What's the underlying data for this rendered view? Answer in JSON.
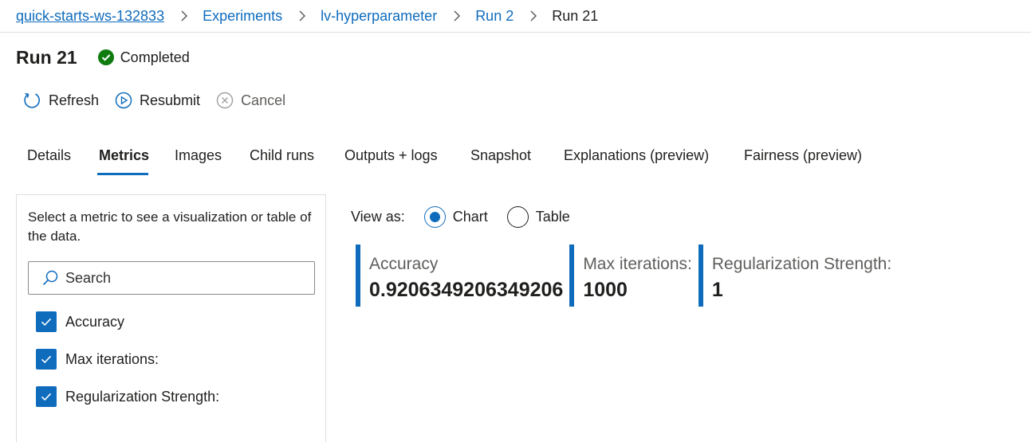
{
  "breadcrumb": {
    "items": [
      "quick-starts-ws-132833",
      "Experiments",
      "lv-hyperparameter",
      "Run 2"
    ],
    "current": "Run 21"
  },
  "header": {
    "title": "Run 21",
    "status": "Completed",
    "status_color": "#107c10"
  },
  "toolbar": {
    "refresh_label": "Refresh",
    "resubmit_label": "Resubmit",
    "cancel_label": "Cancel"
  },
  "tabs": [
    "Details",
    "Metrics",
    "Images",
    "Child runs",
    "Outputs + logs",
    "Snapshot",
    "Explanations (preview)",
    "Fairness (preview)"
  ],
  "active_tab": "Metrics",
  "left_panel": {
    "description": "Select a metric to see a visualization or table of the data.",
    "search_placeholder": "Search",
    "metrics": [
      "Accuracy",
      "Max iterations:",
      "Regularization Strength:"
    ]
  },
  "view_as": {
    "label": "View as:",
    "options": [
      "Chart",
      "Table"
    ],
    "selected": "Chart"
  },
  "cards": [
    {
      "label": "Accuracy",
      "value": "0.9206349206349206"
    },
    {
      "label": "Max iterations:",
      "value": "1000"
    },
    {
      "label": "Regularization Strength:",
      "value": "1"
    }
  ],
  "accent_color": "#0f6cbd"
}
